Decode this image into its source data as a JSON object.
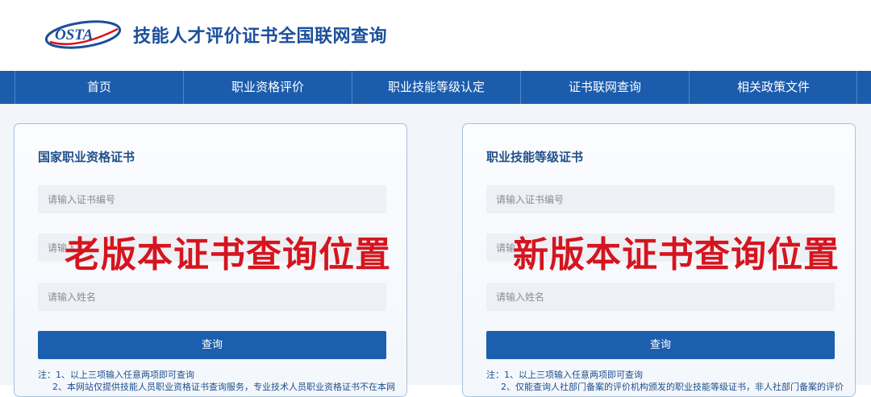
{
  "header": {
    "logo_text": "OSTA",
    "site_title": "技能人才评价证书全国联网查询"
  },
  "nav": {
    "items": [
      {
        "label": "首页"
      },
      {
        "label": "职业资格评价"
      },
      {
        "label": "职业技能等级认定"
      },
      {
        "label": "证书联网查询"
      },
      {
        "label": "相关政策文件"
      }
    ],
    "bg_color": "#1b5cad"
  },
  "cards": [
    {
      "title": "国家职业资格证书",
      "fields": [
        {
          "placeholder": "请输入证书编号"
        },
        {
          "placeholder": "请输入..."
        },
        {
          "placeholder": "请输入姓名"
        }
      ],
      "button_label": "查询",
      "note_line1": "注：1、以上三项输入任意两项即可查询",
      "note_line2": "2、本网站仅提供技能人员职业资格证书查询服务，专业技术人员职业资格证书不在本网"
    },
    {
      "title": "职业技能等级证书",
      "fields": [
        {
          "placeholder": "请输入证书编号"
        },
        {
          "placeholder": "请输..."
        },
        {
          "placeholder": "请输入姓名"
        }
      ],
      "button_label": "查询",
      "note_line1": "注：1、以上三项输入任意两项即可查询",
      "note_line2": "2、仅能查询人社部门备案的评价机构颁发的职业技能等级证书，非人社部门备案的评价"
    }
  ],
  "overlays": {
    "left": "老版本证书查询位置",
    "right": "新版本证书查询位置",
    "color": "#d4151f"
  },
  "colors": {
    "brand_blue": "#1b5cad",
    "title_blue": "#1f4f8a"
  }
}
